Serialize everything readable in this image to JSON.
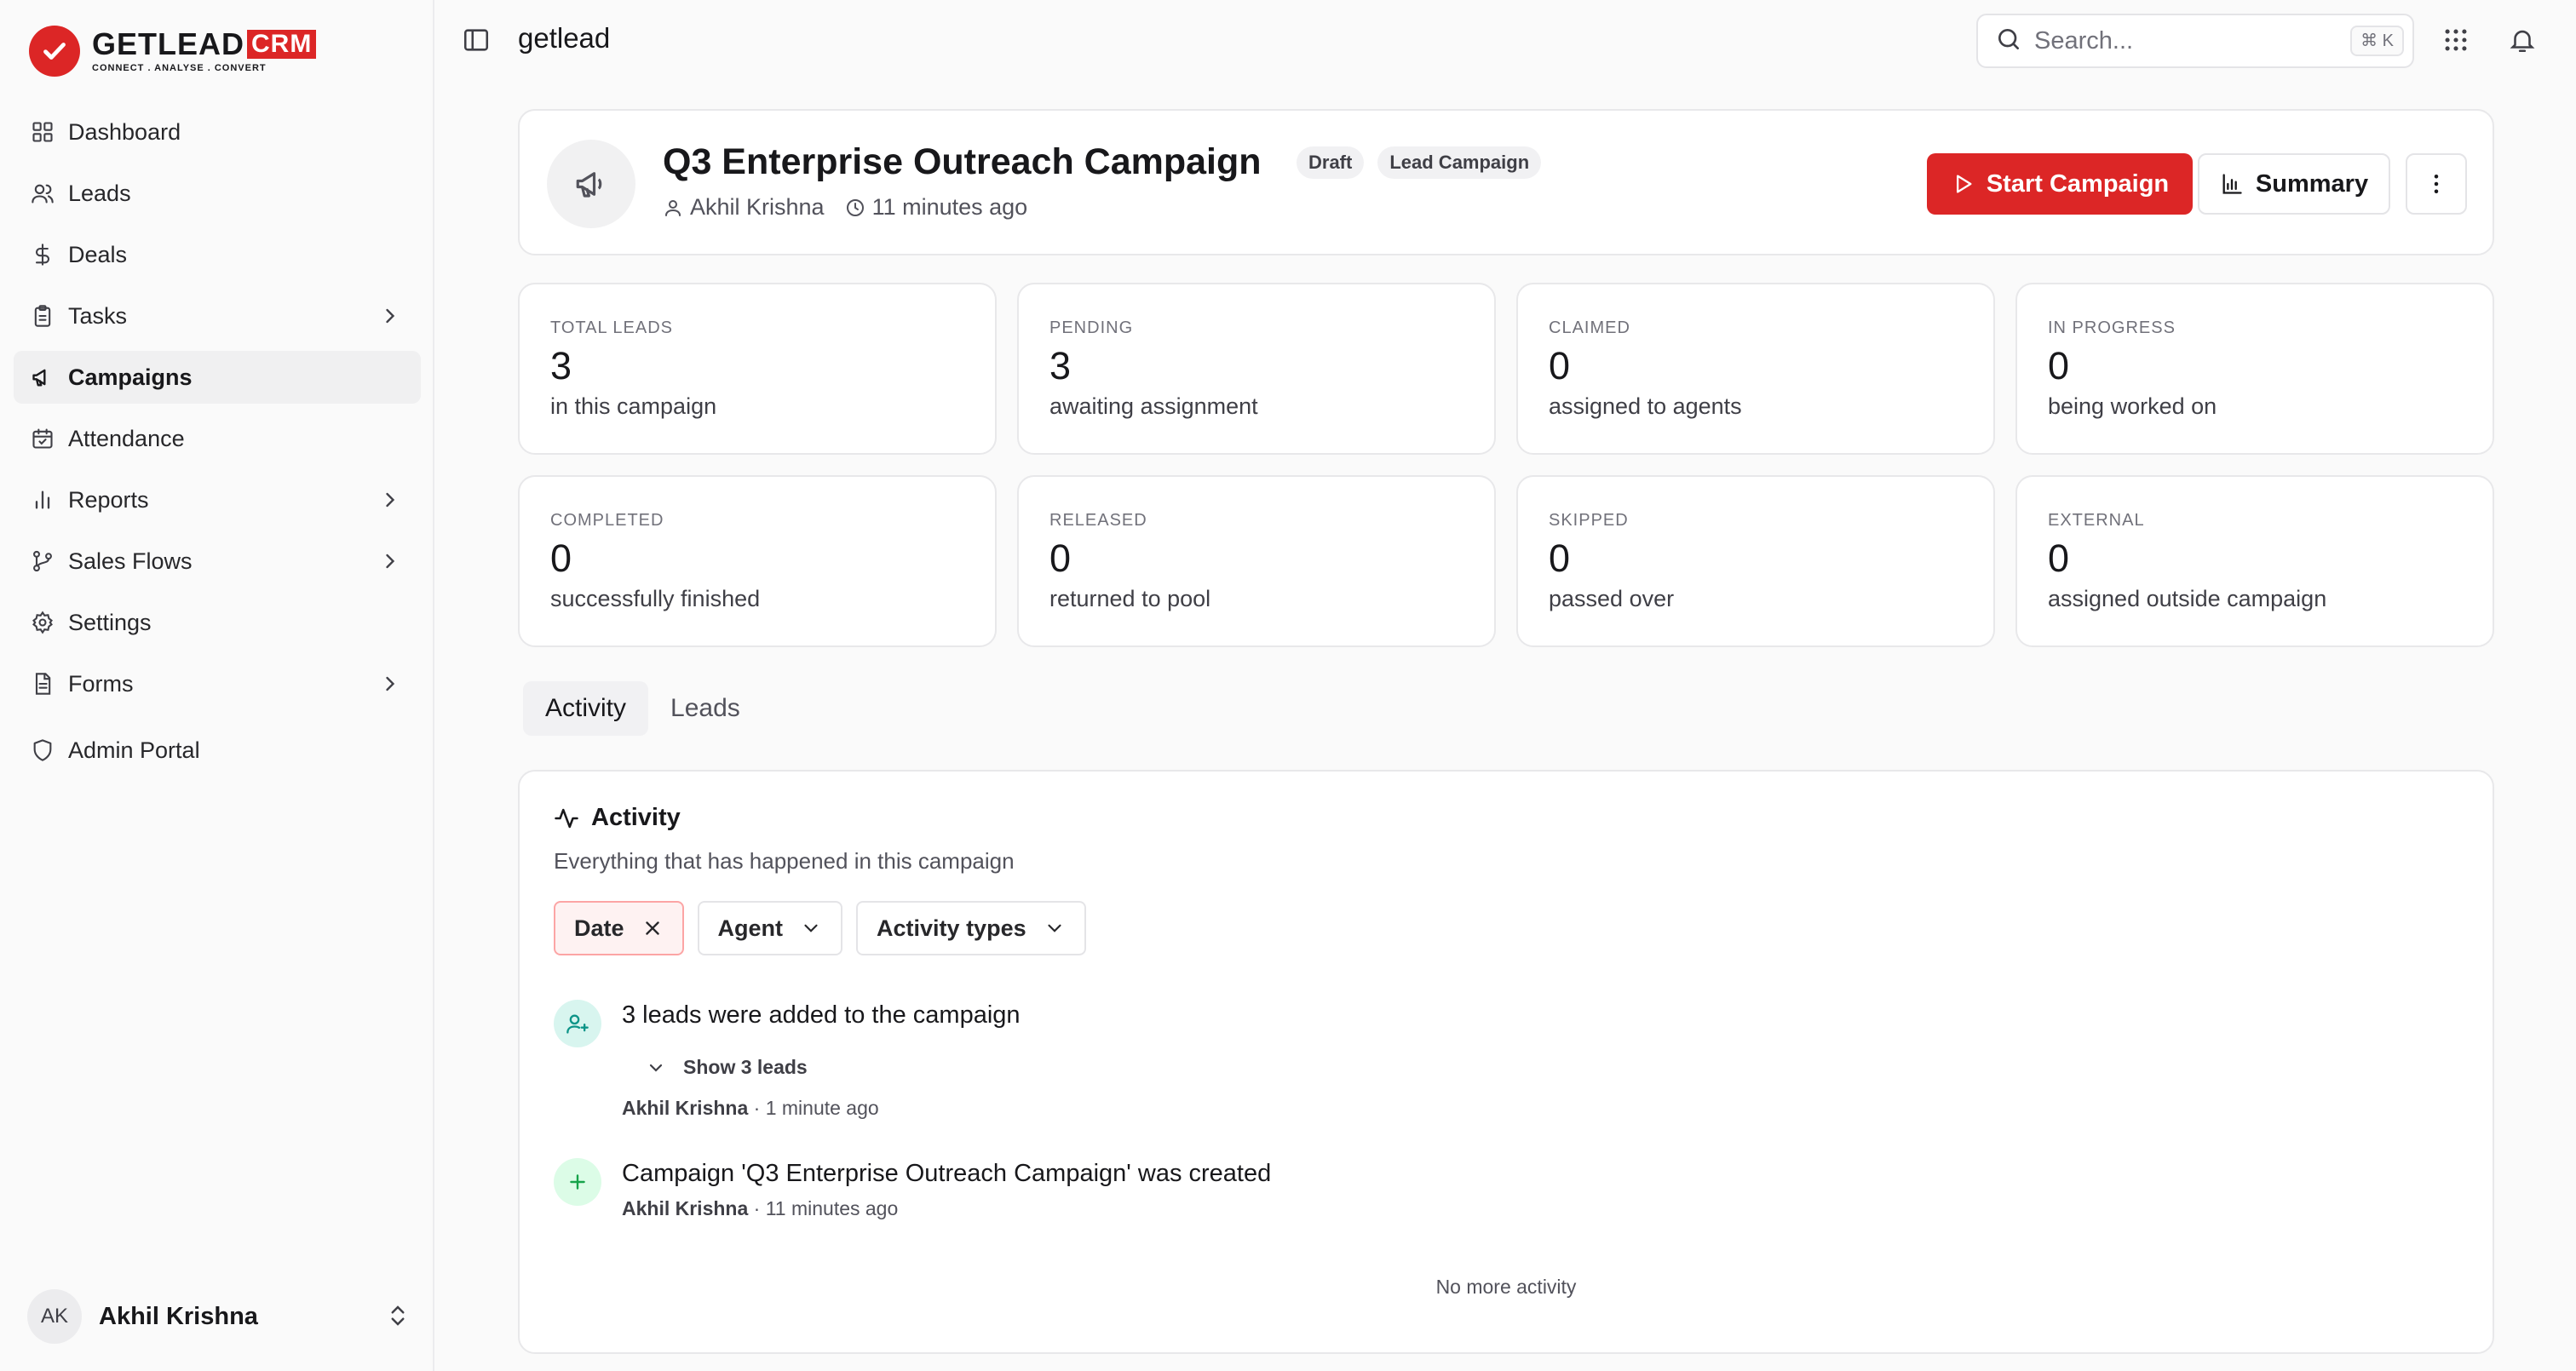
{
  "brand": {
    "name": "GETLEAD",
    "suffix": "CRM",
    "tagline": "CONNECT . ANALYSE . CONVERT",
    "accent": "#dc2626"
  },
  "sidebar": {
    "items": [
      {
        "label": "Dashboard",
        "icon": "grid-icon"
      },
      {
        "label": "Leads",
        "icon": "users-icon"
      },
      {
        "label": "Deals",
        "icon": "dollar-icon"
      },
      {
        "label": "Tasks",
        "icon": "clipboard-icon"
      },
      {
        "label": "Campaigns",
        "icon": "megaphone-icon"
      },
      {
        "label": "Attendance",
        "icon": "calendar-check-icon"
      },
      {
        "label": "Reports",
        "icon": "bar-chart-icon"
      },
      {
        "label": "Sales Flows",
        "icon": "git-branch-icon"
      },
      {
        "label": "Settings",
        "icon": "gear-icon"
      },
      {
        "label": "Forms",
        "icon": "document-icon"
      },
      {
        "label": "Admin Portal",
        "icon": "shield-icon"
      }
    ],
    "user": {
      "initials": "AK",
      "name": "Akhil Krishna"
    }
  },
  "topbar": {
    "app_name": "getlead",
    "search_placeholder": "Search...",
    "shortcut": "⌘ K"
  },
  "campaign": {
    "title": "Q3 Enterprise Outreach Campaign",
    "badges": [
      "Draft",
      "Lead Campaign"
    ],
    "owner": "Akhil Krishna",
    "created": "11 minutes ago",
    "start_label": "Start Campaign",
    "summary_label": "Summary"
  },
  "stats": [
    {
      "label": "TOTAL LEADS",
      "value": "3",
      "desc": "in this campaign"
    },
    {
      "label": "PENDING",
      "value": "3",
      "desc": "awaiting assignment"
    },
    {
      "label": "CLAIMED",
      "value": "0",
      "desc": "assigned to agents"
    },
    {
      "label": "IN PROGRESS",
      "value": "0",
      "desc": "being worked on"
    },
    {
      "label": "COMPLETED",
      "value": "0",
      "desc": "successfully finished"
    },
    {
      "label": "RELEASED",
      "value": "0",
      "desc": "returned to pool"
    },
    {
      "label": "SKIPPED",
      "value": "0",
      "desc": "passed over"
    },
    {
      "label": "EXTERNAL",
      "value": "0",
      "desc": "assigned outside campaign"
    }
  ],
  "tabs": [
    "Activity",
    "Leads"
  ],
  "activity": {
    "title": "Activity",
    "subtitle": "Everything that has happened in this campaign",
    "filters": [
      "Date",
      "Agent",
      "Activity types"
    ],
    "events": [
      {
        "title": "3 leads were added to the campaign",
        "toggle": "Show 3 leads",
        "author": "Akhil Krishna",
        "time": " · 1 minute ago"
      },
      {
        "title": "Campaign 'Q3 Enterprise Outreach Campaign' was created",
        "author": "Akhil Krishna",
        "time": " · 11 minutes ago"
      }
    ],
    "end_text": "No more activity"
  }
}
